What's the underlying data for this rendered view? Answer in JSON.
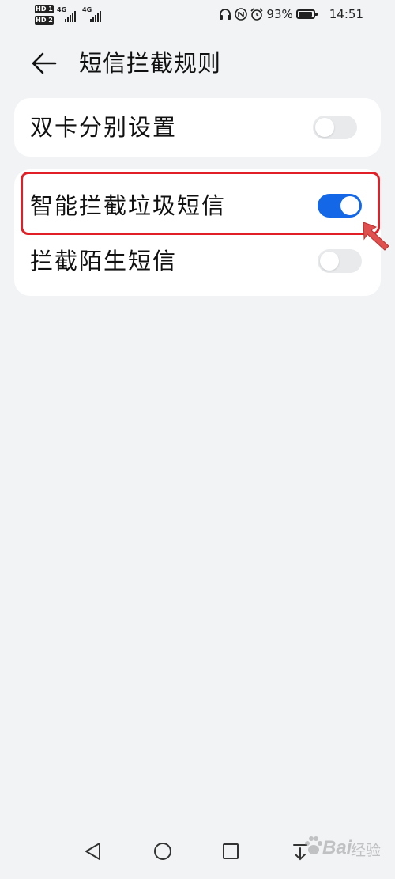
{
  "status_bar": {
    "sim1_badge": "HD 1",
    "sim2_badge": "HD 2",
    "network1": "4G",
    "network2": "4G",
    "battery_percent": "93%",
    "battery_level": 0.93,
    "time": "14:51",
    "icons": [
      "headphones-icon",
      "alarm-icon",
      "battery-icon"
    ]
  },
  "header": {
    "title": "短信拦截规则",
    "back_icon": "arrow-left-icon"
  },
  "settings": {
    "dual_sim": {
      "label": "双卡分别设置",
      "enabled": false
    },
    "smart_block": {
      "label": "智能拦截垃圾短信",
      "enabled": true
    },
    "block_stranger": {
      "label": "拦截陌生短信",
      "enabled": false
    }
  },
  "colors": {
    "toggle_on": "#1468e8",
    "toggle_off": "#e9eaec",
    "highlight": "#e01f26",
    "background": "#f1f3f5"
  },
  "nav_bar": {
    "icons": [
      "back-triangle-icon",
      "home-circle-icon",
      "recents-square-icon",
      "dropdown-icon"
    ]
  },
  "watermark": {
    "brand": "Bai",
    "sub": "经验"
  }
}
